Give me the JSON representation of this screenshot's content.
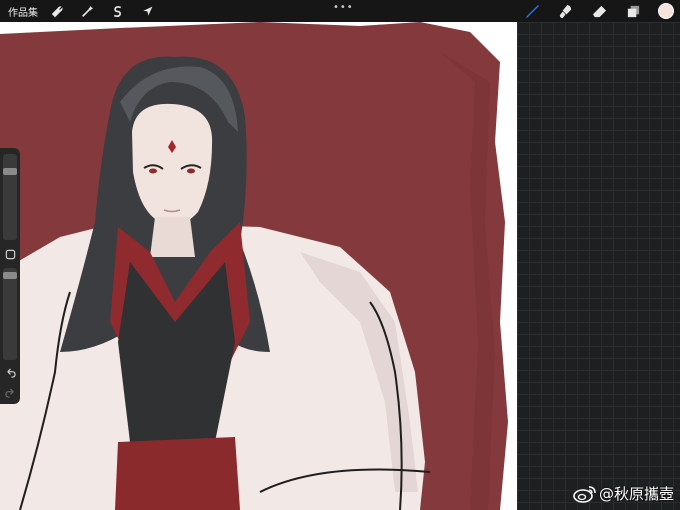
{
  "toolbar": {
    "gallery_label": "作品集",
    "more_label": "•••",
    "icons": [
      "wrench-icon",
      "magic-wand-icon",
      "selection-s-icon",
      "arrow-cursor-icon"
    ],
    "right_icons": [
      "brush-icon",
      "smudge-icon",
      "eraser-icon",
      "layers-icon"
    ],
    "current_color": "#f5e3dc",
    "accent_color": "#2f7bf6"
  },
  "sidebar": {
    "brush_size_fraction": 0.2,
    "opacity_fraction": 0.05,
    "modify_button": "square-icon",
    "undo": "undo-arrow-icon",
    "redo": "redo-arrow-icon"
  },
  "canvas": {
    "background_color": "#843a3d",
    "paper_color": "#ffffff"
  },
  "watermark": {
    "platform_icon": "weibo-icon",
    "text": "@秋原攜壺"
  }
}
